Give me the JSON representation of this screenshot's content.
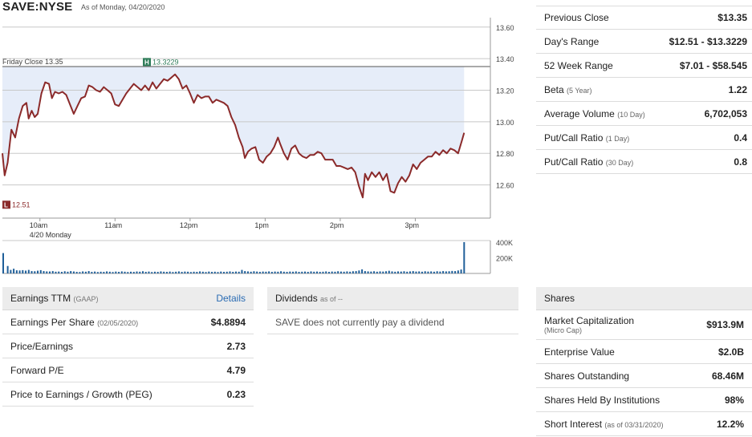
{
  "header": {
    "ticker": "SAVE:NYSE",
    "asof": "As of Monday, 04/20/2020"
  },
  "chart_data": {
    "type": "line",
    "y_ticks": [
      "13.60",
      "13.40",
      "13.20",
      "13.00",
      "12.80",
      "12.60"
    ],
    "y_tick_values": [
      13.6,
      13.4,
      13.2,
      13.0,
      12.8,
      12.6
    ],
    "ylim": [
      12.42,
      13.66
    ],
    "x_ticks": [
      "10am",
      "11am",
      "12pm",
      "1pm",
      "2pm",
      "3pm"
    ],
    "x_tick_hours": [
      10,
      11,
      12,
      13,
      14,
      15
    ],
    "x_range_hours": [
      9.5,
      16.0
    ],
    "date_label": "4/20 Monday",
    "prev_close_label": "Friday Close 13.35",
    "prev_close": 13.35,
    "high_marker": {
      "letter": "H",
      "label": "13.3229",
      "value": 13.3229,
      "hour": 11.82
    },
    "low_marker": {
      "letter": "L",
      "label": "12.51",
      "value": 12.51
    },
    "series": [
      {
        "points": [
          [
            9.5,
            12.8
          ],
          [
            9.53,
            12.66
          ],
          [
            9.57,
            12.74
          ],
          [
            9.62,
            12.95
          ],
          [
            9.67,
            12.9
          ],
          [
            9.72,
            13.02
          ],
          [
            9.77,
            13.1
          ],
          [
            9.82,
            13.12
          ],
          [
            9.85,
            13.02
          ],
          [
            9.89,
            13.07
          ],
          [
            9.93,
            13.03
          ],
          [
            9.97,
            13.05
          ],
          [
            10.02,
            13.18
          ],
          [
            10.07,
            13.25
          ],
          [
            10.12,
            13.24
          ],
          [
            10.16,
            13.15
          ],
          [
            10.2,
            13.19
          ],
          [
            10.25,
            13.18
          ],
          [
            10.3,
            13.19
          ],
          [
            10.35,
            13.17
          ],
          [
            10.4,
            13.11
          ],
          [
            10.45,
            13.05
          ],
          [
            10.5,
            13.1
          ],
          [
            10.55,
            13.15
          ],
          [
            10.6,
            13.16
          ],
          [
            10.65,
            13.23
          ],
          [
            10.7,
            13.22
          ],
          [
            10.75,
            13.2
          ],
          [
            10.8,
            13.19
          ],
          [
            10.85,
            13.22
          ],
          [
            10.9,
            13.2
          ],
          [
            10.95,
            13.18
          ],
          [
            11.0,
            13.11
          ],
          [
            11.05,
            13.1
          ],
          [
            11.1,
            13.14
          ],
          [
            11.15,
            13.18
          ],
          [
            11.2,
            13.21
          ],
          [
            11.25,
            13.24
          ],
          [
            11.3,
            13.22
          ],
          [
            11.35,
            13.2
          ],
          [
            11.4,
            13.23
          ],
          [
            11.45,
            13.2
          ],
          [
            11.5,
            13.25
          ],
          [
            11.55,
            13.21
          ],
          [
            11.6,
            13.24
          ],
          [
            11.65,
            13.27
          ],
          [
            11.7,
            13.26
          ],
          [
            11.75,
            13.28
          ],
          [
            11.8,
            13.3
          ],
          [
            11.85,
            13.27
          ],
          [
            11.9,
            13.21
          ],
          [
            11.95,
            13.23
          ],
          [
            12.0,
            13.18
          ],
          [
            12.05,
            13.12
          ],
          [
            12.1,
            13.17
          ],
          [
            12.15,
            13.15
          ],
          [
            12.2,
            13.16
          ],
          [
            12.25,
            13.16
          ],
          [
            12.3,
            13.12
          ],
          [
            12.35,
            13.14
          ],
          [
            12.4,
            13.13
          ],
          [
            12.45,
            13.12
          ],
          [
            12.5,
            13.1
          ],
          [
            12.55,
            13.03
          ],
          [
            12.6,
            12.98
          ],
          [
            12.65,
            12.9
          ],
          [
            12.7,
            12.84
          ],
          [
            12.73,
            12.77
          ],
          [
            12.77,
            12.81
          ],
          [
            12.82,
            12.83
          ],
          [
            12.87,
            12.84
          ],
          [
            12.92,
            12.76
          ],
          [
            12.97,
            12.74
          ],
          [
            13.02,
            12.78
          ],
          [
            13.07,
            12.8
          ],
          [
            13.12,
            12.84
          ],
          [
            13.17,
            12.9
          ],
          [
            13.2,
            12.86
          ],
          [
            13.25,
            12.8
          ],
          [
            13.3,
            12.76
          ],
          [
            13.35,
            12.83
          ],
          [
            13.4,
            12.85
          ],
          [
            13.45,
            12.8
          ],
          [
            13.5,
            12.78
          ],
          [
            13.55,
            12.77
          ],
          [
            13.6,
            12.79
          ],
          [
            13.65,
            12.79
          ],
          [
            13.7,
            12.81
          ],
          [
            13.75,
            12.8
          ],
          [
            13.8,
            12.76
          ],
          [
            13.85,
            12.76
          ],
          [
            13.9,
            12.76
          ],
          [
            13.95,
            12.72
          ],
          [
            14.0,
            12.72
          ],
          [
            14.05,
            12.71
          ],
          [
            14.1,
            12.7
          ],
          [
            14.15,
            12.71
          ],
          [
            14.2,
            12.68
          ],
          [
            14.25,
            12.59
          ],
          [
            14.3,
            12.52
          ],
          [
            14.33,
            12.67
          ],
          [
            14.37,
            12.63
          ],
          [
            14.42,
            12.68
          ],
          [
            14.47,
            12.65
          ],
          [
            14.52,
            12.68
          ],
          [
            14.57,
            12.63
          ],
          [
            14.62,
            12.67
          ],
          [
            14.67,
            12.56
          ],
          [
            14.72,
            12.55
          ],
          [
            14.77,
            12.61
          ],
          [
            14.82,
            12.65
          ],
          [
            14.87,
            12.62
          ],
          [
            14.92,
            12.66
          ],
          [
            14.97,
            12.73
          ],
          [
            15.02,
            12.7
          ],
          [
            15.07,
            12.74
          ],
          [
            15.12,
            12.76
          ],
          [
            15.17,
            12.78
          ],
          [
            15.22,
            12.78
          ],
          [
            15.27,
            12.81
          ],
          [
            15.32,
            12.79
          ],
          [
            15.37,
            12.82
          ],
          [
            15.42,
            12.8
          ],
          [
            15.47,
            12.83
          ],
          [
            15.52,
            12.82
          ],
          [
            15.57,
            12.8
          ],
          [
            15.62,
            12.88
          ],
          [
            15.65,
            12.93
          ]
        ]
      }
    ],
    "volume": {
      "y_ticks": [
        "400K",
        "200K"
      ],
      "y_tick_values": [
        400000,
        200000
      ],
      "ymax": 420000,
      "bars": [
        [
          9.5,
          260000
        ],
        [
          9.56,
          95000
        ],
        [
          9.6,
          45000
        ],
        [
          9.64,
          60000
        ],
        [
          9.68,
          40000
        ],
        [
          9.72,
          38000
        ],
        [
          9.76,
          42000
        ],
        [
          9.8,
          36000
        ],
        [
          9.84,
          45000
        ],
        [
          9.88,
          30000
        ],
        [
          9.92,
          28000
        ],
        [
          9.96,
          35000
        ],
        [
          10.0,
          42000
        ],
        [
          10.04,
          30000
        ],
        [
          10.08,
          26000
        ],
        [
          10.12,
          25000
        ],
        [
          10.16,
          30000
        ],
        [
          10.2,
          22000
        ],
        [
          10.24,
          24000
        ],
        [
          10.28,
          20000
        ],
        [
          10.32,
          28000
        ],
        [
          10.36,
          22000
        ],
        [
          10.4,
          30000
        ],
        [
          10.44,
          25000
        ],
        [
          10.48,
          20000
        ],
        [
          10.52,
          18000
        ],
        [
          10.56,
          26000
        ],
        [
          10.6,
          22000
        ],
        [
          10.64,
          30000
        ],
        [
          10.68,
          20000
        ],
        [
          10.72,
          24000
        ],
        [
          10.76,
          18000
        ],
        [
          10.8,
          22000
        ],
        [
          10.84,
          20000
        ],
        [
          10.88,
          26000
        ],
        [
          10.92,
          22000
        ],
        [
          10.96,
          18000
        ],
        [
          11.0,
          24000
        ],
        [
          11.04,
          20000
        ],
        [
          11.08,
          26000
        ],
        [
          11.12,
          22000
        ],
        [
          11.16,
          18000
        ],
        [
          11.2,
          22000
        ],
        [
          11.24,
          20000
        ],
        [
          11.28,
          25000
        ],
        [
          11.32,
          22000
        ],
        [
          11.36,
          28000
        ],
        [
          11.4,
          20000
        ],
        [
          11.44,
          24000
        ],
        [
          11.48,
          18000
        ],
        [
          11.52,
          22000
        ],
        [
          11.56,
          20000
        ],
        [
          11.6,
          26000
        ],
        [
          11.64,
          22000
        ],
        [
          11.68,
          20000
        ],
        [
          11.72,
          24000
        ],
        [
          11.76,
          18000
        ],
        [
          11.8,
          22000
        ],
        [
          11.84,
          26000
        ],
        [
          11.88,
          20000
        ],
        [
          11.92,
          24000
        ],
        [
          11.96,
          22000
        ],
        [
          12.0,
          18000
        ],
        [
          12.04,
          22000
        ],
        [
          12.08,
          20000
        ],
        [
          12.12,
          26000
        ],
        [
          12.16,
          22000
        ],
        [
          12.2,
          18000
        ],
        [
          12.24,
          24000
        ],
        [
          12.28,
          20000
        ],
        [
          12.32,
          22000
        ],
        [
          12.36,
          18000
        ],
        [
          12.4,
          24000
        ],
        [
          12.44,
          20000
        ],
        [
          12.48,
          22000
        ],
        [
          12.52,
          26000
        ],
        [
          12.56,
          20000
        ],
        [
          12.6,
          24000
        ],
        [
          12.64,
          22000
        ],
        [
          12.68,
          45000
        ],
        [
          12.72,
          30000
        ],
        [
          12.76,
          26000
        ],
        [
          12.8,
          22000
        ],
        [
          12.84,
          28000
        ],
        [
          12.88,
          24000
        ],
        [
          12.92,
          20000
        ],
        [
          12.96,
          24000
        ],
        [
          13.0,
          22000
        ],
        [
          13.04,
          26000
        ],
        [
          13.08,
          20000
        ],
        [
          13.12,
          24000
        ],
        [
          13.16,
          22000
        ],
        [
          13.2,
          28000
        ],
        [
          13.24,
          22000
        ],
        [
          13.28,
          20000
        ],
        [
          13.32,
          24000
        ],
        [
          13.36,
          22000
        ],
        [
          13.4,
          26000
        ],
        [
          13.44,
          20000
        ],
        [
          13.48,
          22000
        ],
        [
          13.52,
          24000
        ],
        [
          13.56,
          20000
        ],
        [
          13.6,
          26000
        ],
        [
          13.64,
          22000
        ],
        [
          13.68,
          24000
        ],
        [
          13.72,
          20000
        ],
        [
          13.76,
          22000
        ],
        [
          13.8,
          26000
        ],
        [
          13.84,
          20000
        ],
        [
          13.88,
          24000
        ],
        [
          13.92,
          22000
        ],
        [
          13.96,
          28000
        ],
        [
          14.0,
          24000
        ],
        [
          14.04,
          22000
        ],
        [
          14.08,
          26000
        ],
        [
          14.12,
          22000
        ],
        [
          14.16,
          28000
        ],
        [
          14.2,
          30000
        ],
        [
          14.24,
          38000
        ],
        [
          14.28,
          52000
        ],
        [
          14.32,
          30000
        ],
        [
          14.36,
          26000
        ],
        [
          14.4,
          24000
        ],
        [
          14.44,
          28000
        ],
        [
          14.48,
          22000
        ],
        [
          14.52,
          26000
        ],
        [
          14.56,
          24000
        ],
        [
          14.6,
          28000
        ],
        [
          14.64,
          34000
        ],
        [
          14.68,
          26000
        ],
        [
          14.72,
          22000
        ],
        [
          14.76,
          26000
        ],
        [
          14.8,
          24000
        ],
        [
          14.84,
          28000
        ],
        [
          14.88,
          22000
        ],
        [
          14.92,
          26000
        ],
        [
          14.96,
          30000
        ],
        [
          15.0,
          24000
        ],
        [
          15.04,
          26000
        ],
        [
          15.08,
          22000
        ],
        [
          15.12,
          28000
        ],
        [
          15.16,
          24000
        ],
        [
          15.2,
          26000
        ],
        [
          15.24,
          22000
        ],
        [
          15.28,
          28000
        ],
        [
          15.32,
          24000
        ],
        [
          15.36,
          30000
        ],
        [
          15.4,
          26000
        ],
        [
          15.44,
          28000
        ],
        [
          15.48,
          32000
        ],
        [
          15.52,
          30000
        ],
        [
          15.56,
          38000
        ],
        [
          15.6,
          50000
        ],
        [
          15.64,
          400000
        ]
      ]
    },
    "colors": {
      "line": "#8b2a2a",
      "fill": "#e6edf9",
      "volume": "#1f5f99",
      "prev_close": "#555555",
      "high_marker": "#2f7d5a",
      "low_marker": "#8b2a2a"
    }
  },
  "quote_stats": [
    {
      "label": "Previous Close",
      "sub": "",
      "value": "$13.35"
    },
    {
      "label": "Day's Range",
      "sub": "",
      "value": "$12.51 - $13.3229"
    },
    {
      "label": "52 Week Range",
      "sub": "",
      "value": "$7.01 - $58.545"
    },
    {
      "label": "Beta",
      "sub": "(5 Year)",
      "value": "1.22"
    },
    {
      "label": "Average Volume",
      "sub": "(10 Day)",
      "value": "6,702,053"
    },
    {
      "label": "Put/Call Ratio",
      "sub": "(1 Day)",
      "value": "0.4"
    },
    {
      "label": "Put/Call Ratio",
      "sub": "(30 Day)",
      "value": "0.8"
    }
  ],
  "earnings": {
    "title": "Earnings TTM",
    "title_sub": "(GAAP)",
    "details_link": "Details",
    "rows": [
      {
        "label": "Earnings Per Share",
        "sub": "(02/05/2020)",
        "value": "$4.8894"
      },
      {
        "label": "Price/Earnings",
        "sub": "",
        "value": "2.73"
      },
      {
        "label": "Forward P/E",
        "sub": "",
        "value": "4.79"
      },
      {
        "label": "Price to Earnings / Growth (PEG)",
        "sub": "",
        "value": "0.23"
      }
    ]
  },
  "dividends": {
    "title": "Dividends",
    "title_sub": "as of --",
    "note": "SAVE does not currently pay a dividend"
  },
  "shares": {
    "title": "Shares",
    "rows": [
      {
        "label": "Market Capitalization",
        "sub": "(Micro Cap)",
        "value": "$913.9M"
      },
      {
        "label": "Enterprise Value",
        "sub": "",
        "value": "$2.0B"
      },
      {
        "label": "Shares Outstanding",
        "sub": "",
        "value": "68.46M"
      },
      {
        "label": "Shares Held By Institutions",
        "sub": "",
        "value": "98%"
      },
      {
        "label": "Short Interest",
        "sub": "(as of 03/31/2020)",
        "value": "12.2%"
      }
    ]
  }
}
